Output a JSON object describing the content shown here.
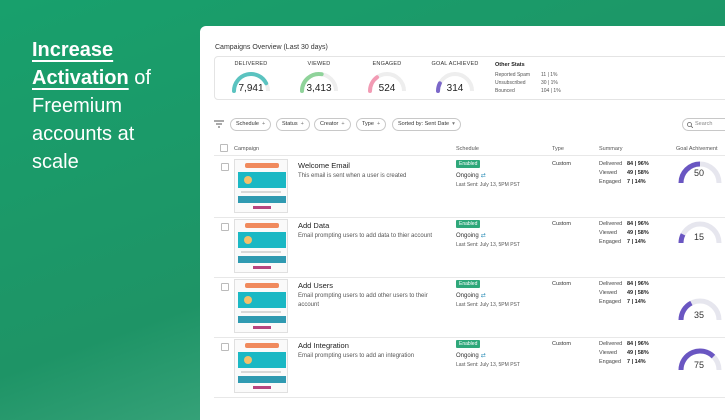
{
  "headline": {
    "line1": "Increase",
    "line2_hl": "Activation",
    "line2_rest": " of",
    "line3": "Freemium",
    "line4": "accounts at",
    "line5": "scale"
  },
  "overview": {
    "title": "Campaigns Overview (Last 30 days)",
    "stats": [
      {
        "label": "Delivered",
        "value": "7,941",
        "color": "#5bc3c0",
        "fraction": 0.85
      },
      {
        "label": "Viewed",
        "value": "3,413",
        "color": "#8fd39a",
        "fraction": 0.55
      },
      {
        "label": "Engaged",
        "value": "524",
        "color": "#f29bb4",
        "fraction": 0.3
      },
      {
        "label": "Goal Achieved",
        "value": "314",
        "color": "#7b67c9",
        "fraction": 0.15
      }
    ],
    "other_stats": {
      "title": "Other Stats",
      "rows": [
        {
          "label": "Reported Spam",
          "value": "11 | 1%"
        },
        {
          "label": "Unsubscribed",
          "value": "30 | 1%"
        },
        {
          "label": "Bounced",
          "value": "104 | 1%"
        }
      ]
    }
  },
  "filters": {
    "chips": [
      "Schedule",
      "Status",
      "Creator",
      "Type"
    ],
    "sort": "Sorted by: Sent Date",
    "search_placeholder": "Search"
  },
  "columns": {
    "campaign": "Campaign",
    "schedule": "Schedule",
    "type": "Type",
    "summary": "Summary",
    "goal": "Goal Achivement"
  },
  "summary_labels": {
    "delivered": "Delivered",
    "viewed": "Viewed",
    "engaged": "Engaged"
  },
  "rows": [
    {
      "name": "Welcome Email",
      "desc": "This email is sent when a user is created",
      "status": "Enabled",
      "schedule": "Ongoing",
      "last_sent": "Last Sent: July 13, 5PM PST",
      "type": "Custom",
      "delivered": "84 | 96%",
      "viewed": "49 | 58%",
      "engaged": "7 | 14%",
      "goal": "50",
      "goal_fraction": 0.5
    },
    {
      "name": "Add Data",
      "desc": "Email prompting users to add data to thier account",
      "status": "Enabled",
      "schedule": "Ongoing",
      "last_sent": "Last Sent: July 13, 5PM PST",
      "type": "Custom",
      "delivered": "84 | 96%",
      "viewed": "49 | 58%",
      "engaged": "7 | 14%",
      "goal": "15",
      "goal_fraction": 0.15
    },
    {
      "name": "Add Users",
      "desc": "Email prompting users to add other users to their account",
      "status": "Enabled",
      "schedule": "Ongoing",
      "last_sent": "Last Sent: July 13, 5PM PST",
      "type": "Custom",
      "delivered": "84 | 96%",
      "viewed": "49 | 58%",
      "engaged": "7 | 14%",
      "goal": "35",
      "goal_fraction": 0.35
    },
    {
      "name": "Add Integration",
      "desc": "Email prompting users to add an integration",
      "status": "Enabled",
      "schedule": "Ongoing",
      "last_sent": "Last Sent: July 13, 5PM PST",
      "type": "Custom",
      "delivered": "84 | 96%",
      "viewed": "49 | 58%",
      "engaged": "7 | 14%",
      "goal": "75",
      "goal_fraction": 0.75
    }
  ],
  "colors": {
    "accent": "#2fa77a",
    "gauge_goal": "#6a56c2",
    "gauge_track": "#e6e6ee"
  }
}
